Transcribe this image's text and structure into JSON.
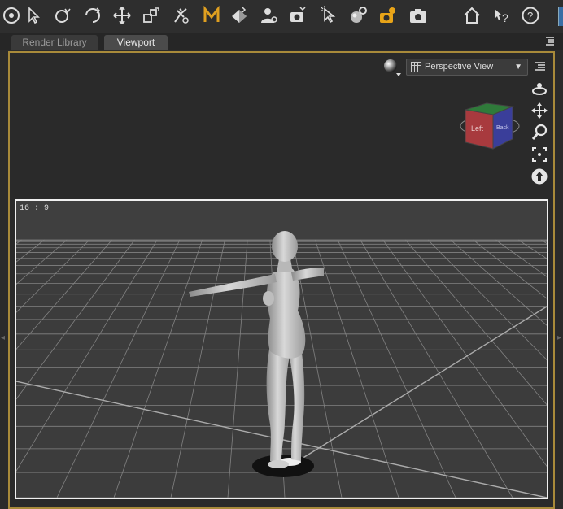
{
  "tabs": [
    {
      "label": "Render Library",
      "active": false
    },
    {
      "label": "Viewport",
      "active": true
    }
  ],
  "toolbar_icons": [
    "node-selection-icon",
    "universal-tool-icon",
    "rotate-tool-icon",
    "translate-tool-icon",
    "scale-tool-icon",
    "joint-editor-icon",
    "morph-brush-icon",
    "surface-selection-icon",
    "geometry-editor-icon",
    "render-settings-icon",
    "spot-render-icon",
    "surface-tool-icon",
    "render-to-new-window-icon",
    "render-icon",
    "home-icon",
    "whats-this-icon",
    "help-icon"
  ],
  "viewport": {
    "camera_label": "Perspective View",
    "aspect_ratio": "16 : 9",
    "view_cube_face": "Left",
    "view_cube_side_face": "Back",
    "accent_color": "#a88a3a"
  }
}
